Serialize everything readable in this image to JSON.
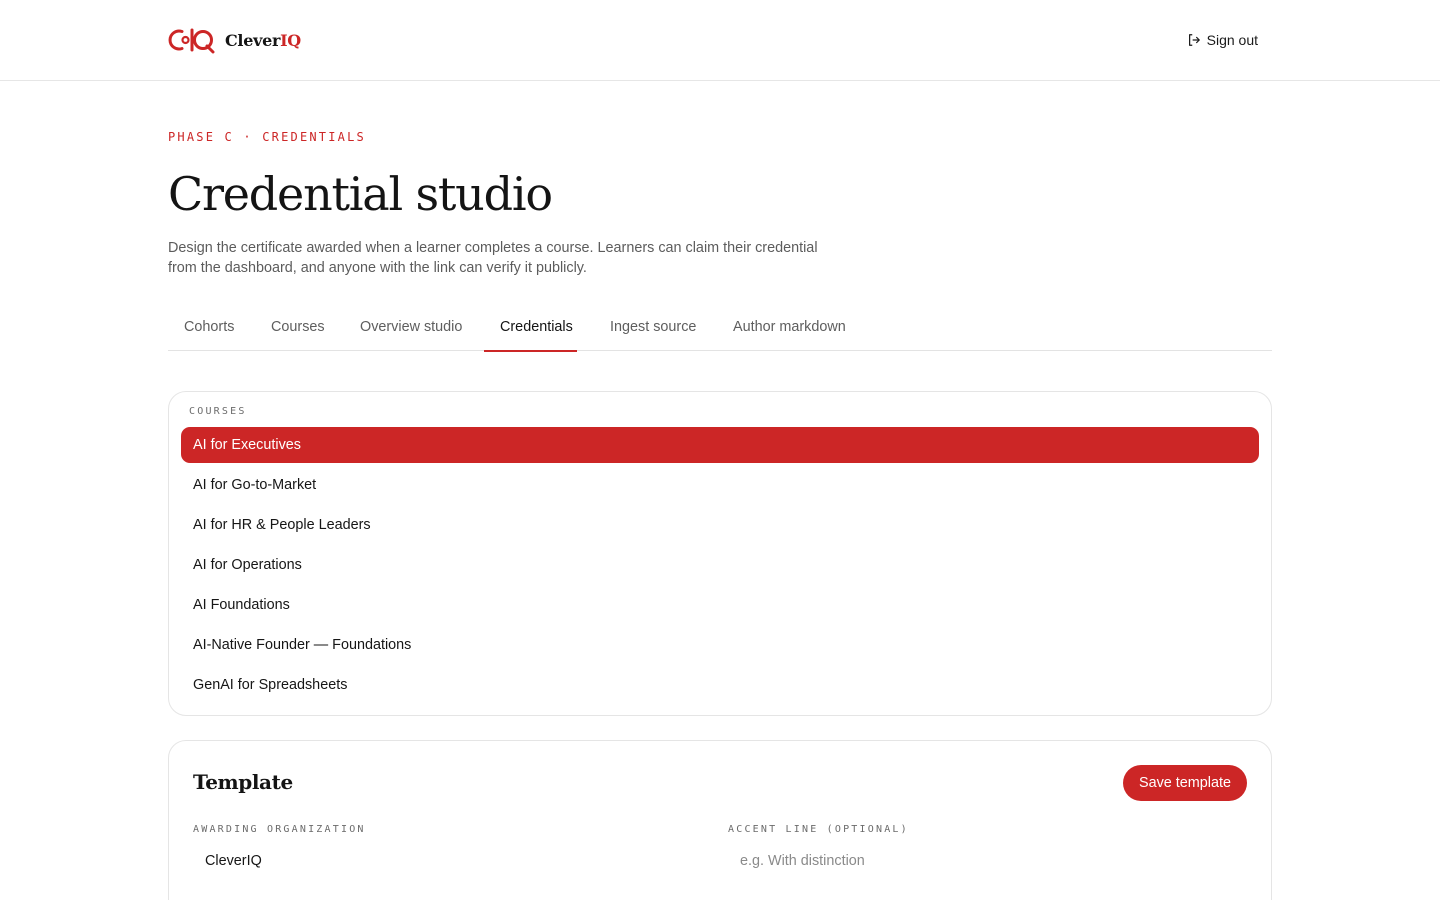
{
  "brand": {
    "name_main": "Clever",
    "name_accent": "IQ",
    "logo_icon": "cleveriq-logo-icon",
    "accent_color": "#cc2626"
  },
  "header": {
    "signout_label": "Sign out",
    "signout_icon": "sign-out-icon"
  },
  "hero": {
    "eyebrow": "PHASE C · CREDENTIALS",
    "title": "Credential studio",
    "description": "Design the certificate awarded when a learner completes a course. Learners can claim their credential from the dashboard, and anyone with the link can verify it publicly."
  },
  "tabs": [
    {
      "label": "Cohorts",
      "active": false
    },
    {
      "label": "Courses",
      "active": false
    },
    {
      "label": "Overview studio",
      "active": false
    },
    {
      "label": "Credentials",
      "active": true
    },
    {
      "label": "Ingest source",
      "active": false
    },
    {
      "label": "Author markdown",
      "active": false
    }
  ],
  "courses": {
    "section_label": "COURSES",
    "items": [
      {
        "label": "AI for Executives",
        "selected": true
      },
      {
        "label": "AI for Go-to-Market",
        "selected": false
      },
      {
        "label": "AI for HR & People Leaders",
        "selected": false
      },
      {
        "label": "AI for Operations",
        "selected": false
      },
      {
        "label": "AI Foundations",
        "selected": false
      },
      {
        "label": "AI-Native Founder — Foundations",
        "selected": false
      },
      {
        "label": "GenAI for Spreadsheets",
        "selected": false
      }
    ]
  },
  "template": {
    "title": "Template",
    "save_label": "Save template",
    "fields": {
      "awarding_org": {
        "label": "AWARDING ORGANIZATION",
        "value": "CleverIQ",
        "placeholder": ""
      },
      "accent_line": {
        "label": "ACCENT LINE (OPTIONAL)",
        "value": "",
        "placeholder": "e.g. With distinction"
      }
    }
  }
}
